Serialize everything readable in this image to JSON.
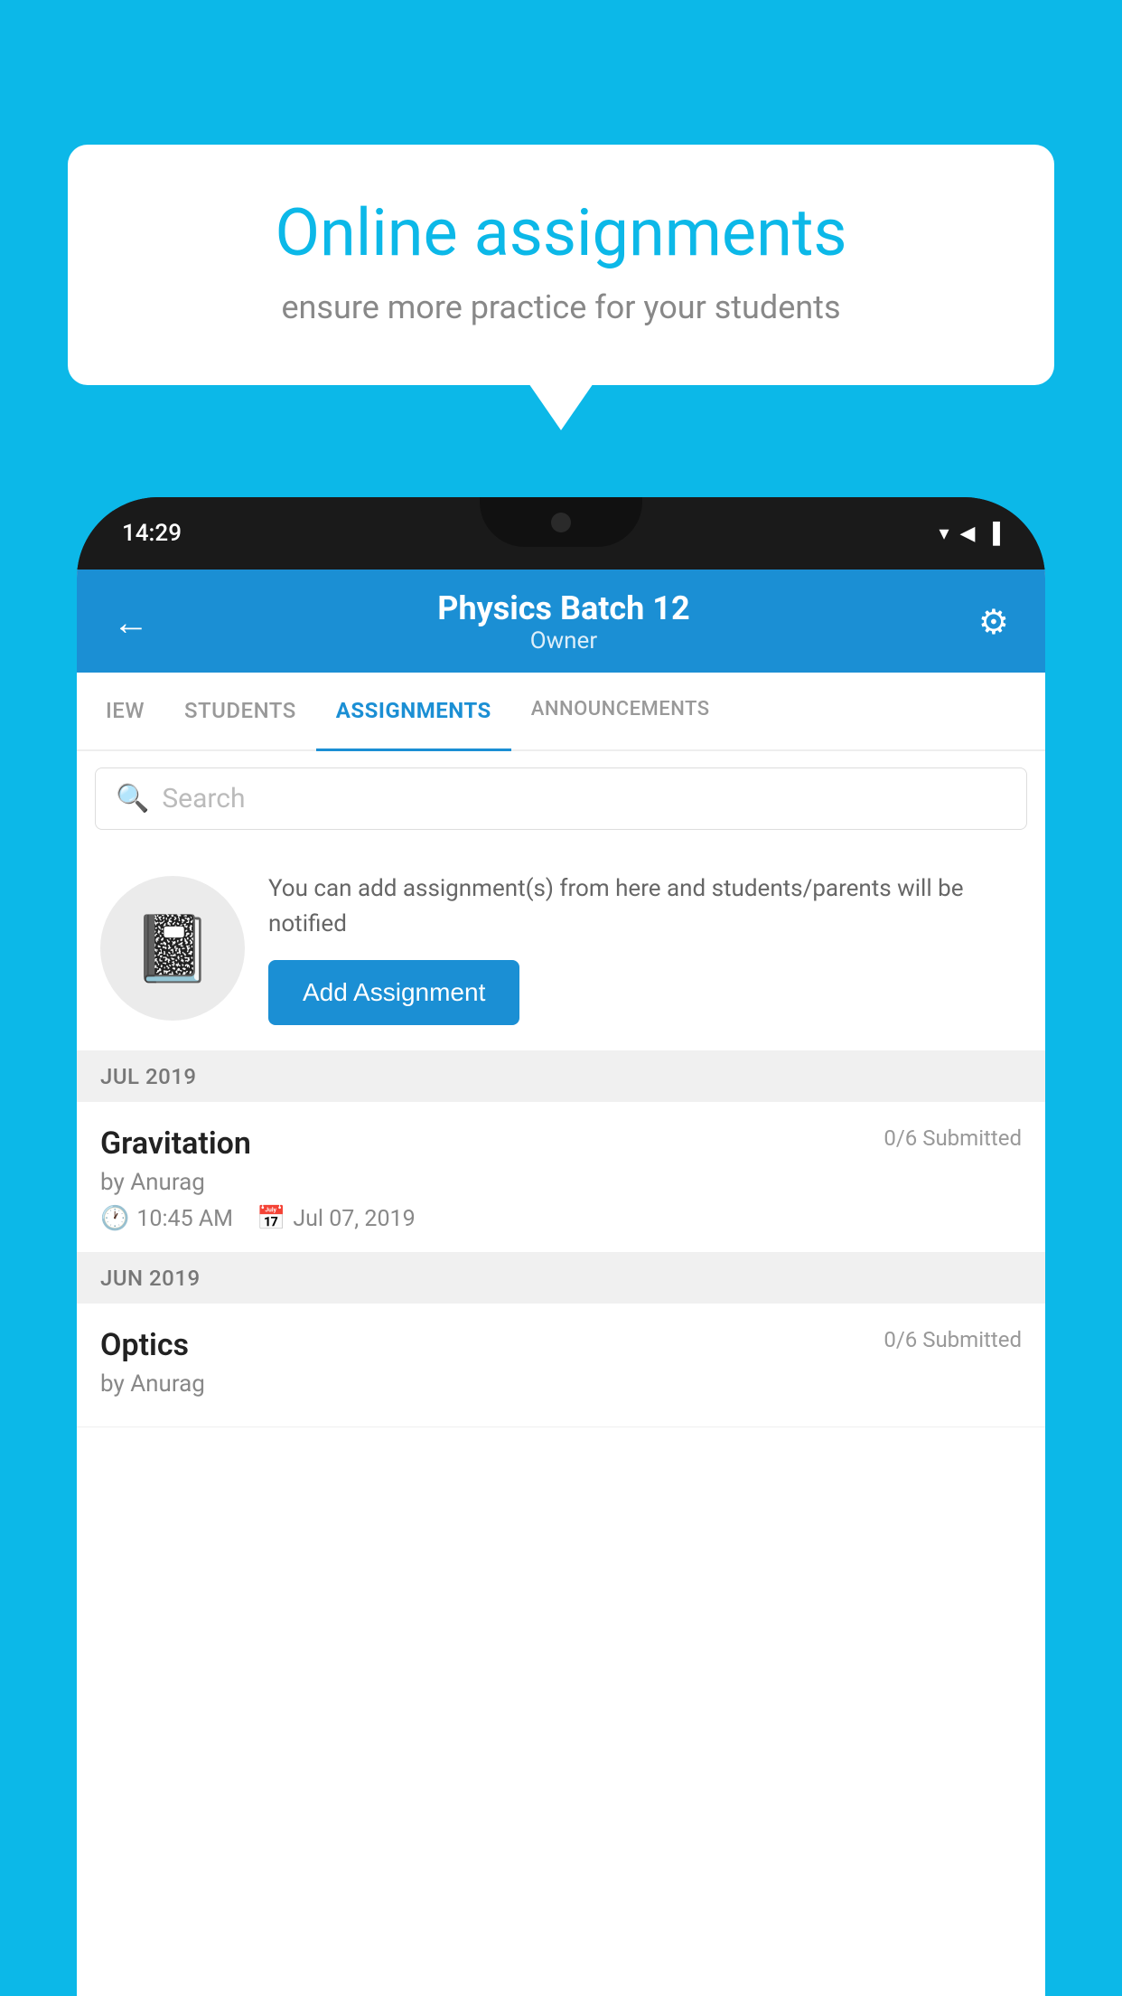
{
  "background": {
    "color": "#0CB8E8"
  },
  "speech_bubble": {
    "title": "Online assignments",
    "subtitle": "ensure more practice for your students"
  },
  "phone": {
    "status_bar": {
      "time": "14:29",
      "wifi": "▾",
      "signal": "▲",
      "battery": "▐"
    },
    "header": {
      "back_label": "←",
      "title": "Physics Batch 12",
      "subtitle": "Owner",
      "gear_label": "⚙"
    },
    "tabs": [
      {
        "label": "IEW",
        "active": false
      },
      {
        "label": "STUDENTS",
        "active": false
      },
      {
        "label": "ASSIGNMENTS",
        "active": true
      },
      {
        "label": "ANNOUNCEMENTS",
        "active": false
      }
    ],
    "search": {
      "placeholder": "Search"
    },
    "promo": {
      "description": "You can add assignment(s) from here and students/parents will be notified",
      "button_label": "Add Assignment"
    },
    "sections": [
      {
        "month": "JUL 2019",
        "assignments": [
          {
            "name": "Gravitation",
            "submitted": "0/6 Submitted",
            "by": "by Anurag",
            "time": "10:45 AM",
            "date": "Jul 07, 2019"
          }
        ]
      },
      {
        "month": "JUN 2019",
        "assignments": [
          {
            "name": "Optics",
            "submitted": "0/6 Submitted",
            "by": "by Anurag",
            "time": "",
            "date": ""
          }
        ]
      }
    ]
  }
}
